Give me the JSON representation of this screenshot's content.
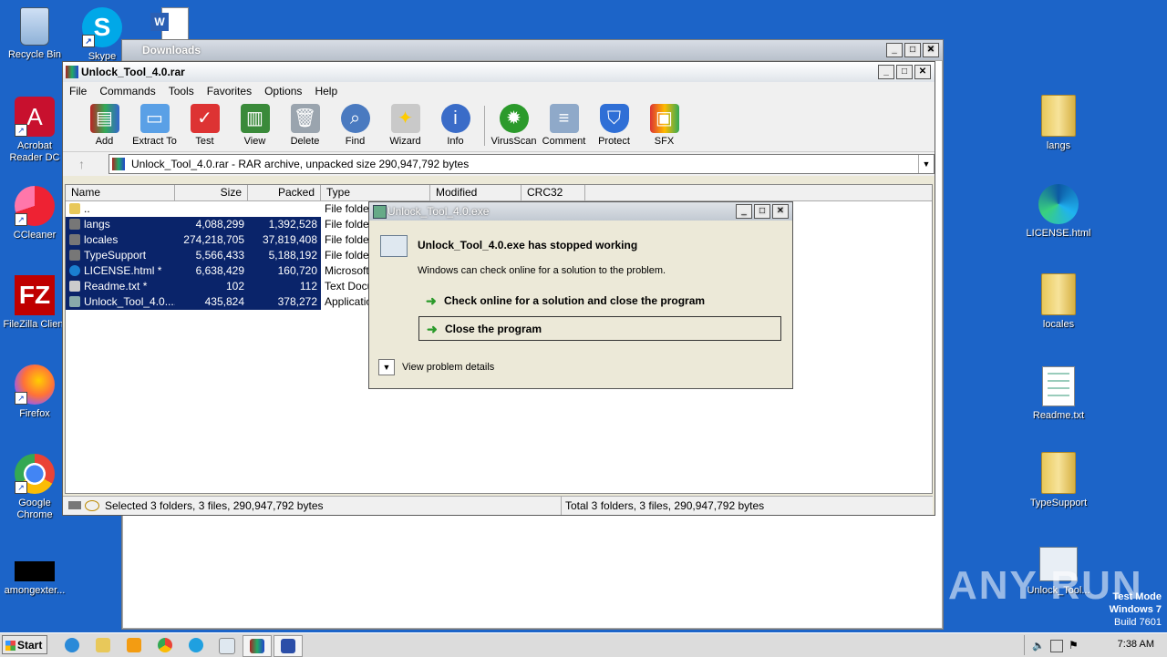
{
  "desktop": {
    "left_icons": [
      {
        "label": "Recycle Bin",
        "icon": "recycle-bin-icon"
      },
      {
        "label": "Skype",
        "icon": "skype-icon"
      },
      {
        "label": "Acrobat Reader DC",
        "icon": "acrobat-icon"
      },
      {
        "label": "CCleaner",
        "icon": "ccleaner-icon"
      },
      {
        "label": "FileZilla Client",
        "icon": "filezilla-icon"
      },
      {
        "label": "Firefox",
        "icon": "firefox-icon"
      },
      {
        "label": "Google Chrome",
        "icon": "chrome-icon"
      },
      {
        "label": "amongexter...",
        "icon": "black-app-icon"
      }
    ],
    "right_icons": [
      {
        "label": "langs",
        "icon": "folder-icon"
      },
      {
        "label": "LICENSE.html",
        "icon": "edge-icon"
      },
      {
        "label": "locales",
        "icon": "folder-icon"
      },
      {
        "label": "Readme.txt",
        "icon": "text-file-icon"
      },
      {
        "label": "TypeSupport",
        "icon": "folder-icon"
      },
      {
        "label": "Unlock_Tool...",
        "icon": "app-icon"
      }
    ],
    "watermark": "ANY RUN",
    "test_mode": [
      "Test Mode",
      "Windows 7",
      "Build 7601"
    ]
  },
  "downloads_window": {
    "title": "Downloads"
  },
  "winrar": {
    "title": "Unlock_Tool_4.0.rar",
    "menu": [
      "File",
      "Commands",
      "Tools",
      "Favorites",
      "Options",
      "Help"
    ],
    "toolbar": [
      {
        "label": "Add",
        "icon": "add-archive-icon"
      },
      {
        "label": "Extract To",
        "icon": "extract-folder-icon"
      },
      {
        "label": "Test",
        "icon": "test-clipboard-icon"
      },
      {
        "label": "View",
        "icon": "view-book-icon"
      },
      {
        "label": "Delete",
        "icon": "trash-icon"
      },
      {
        "label": "Find",
        "icon": "magnifier-icon"
      },
      {
        "label": "Wizard",
        "icon": "wand-icon"
      },
      {
        "label": "Info",
        "icon": "info-icon"
      },
      {
        "label": "VirusScan",
        "icon": "virus-icon"
      },
      {
        "label": "Comment",
        "icon": "comment-icon"
      },
      {
        "label": "Protect",
        "icon": "shield-icon"
      },
      {
        "label": "SFX",
        "icon": "sfx-icon"
      }
    ],
    "address": "Unlock_Tool_4.0.rar - RAR archive, unpacked size 290,947,792 bytes",
    "columns": [
      "Name",
      "Size",
      "Packed",
      "Type",
      "Modified",
      "CRC32"
    ],
    "rows": [
      {
        "name": "..",
        "size": "",
        "packed": "",
        "type": "File folder",
        "selected": false
      },
      {
        "name": "langs",
        "size": "4,088,299",
        "packed": "1,392,528",
        "type": "File folder",
        "selected": true
      },
      {
        "name": "locales",
        "size": "274,218,705",
        "packed": "37,819,408",
        "type": "File folder",
        "selected": true
      },
      {
        "name": "TypeSupport",
        "size": "5,566,433",
        "packed": "5,188,192",
        "type": "File folder",
        "selected": true
      },
      {
        "name": "LICENSE.html *",
        "size": "6,638,429",
        "packed": "160,720",
        "type": "Microsoft",
        "selected": true
      },
      {
        "name": "Readme.txt *",
        "size": "102",
        "packed": "112",
        "type": "Text Docu",
        "selected": true
      },
      {
        "name": "Unlock_Tool_4.0....",
        "size": "435,824",
        "packed": "378,272",
        "type": "Application",
        "selected": true
      }
    ],
    "status_left": "Selected 3 folders, 3 files, 290,947,792 bytes",
    "status_right": "Total 3 folders, 3 files, 290,947,792 bytes"
  },
  "error_dialog": {
    "title": "Unlock_Tool_4.0.exe",
    "heading": "Unlock_Tool_4.0.exe has stopped working",
    "subtext": "Windows can check online for a solution to the problem.",
    "option1": "Check online for a solution and close the program",
    "option2": "Close the program",
    "details": "View problem details"
  },
  "taskbar": {
    "start": "Start",
    "clock": "7:38 AM"
  }
}
